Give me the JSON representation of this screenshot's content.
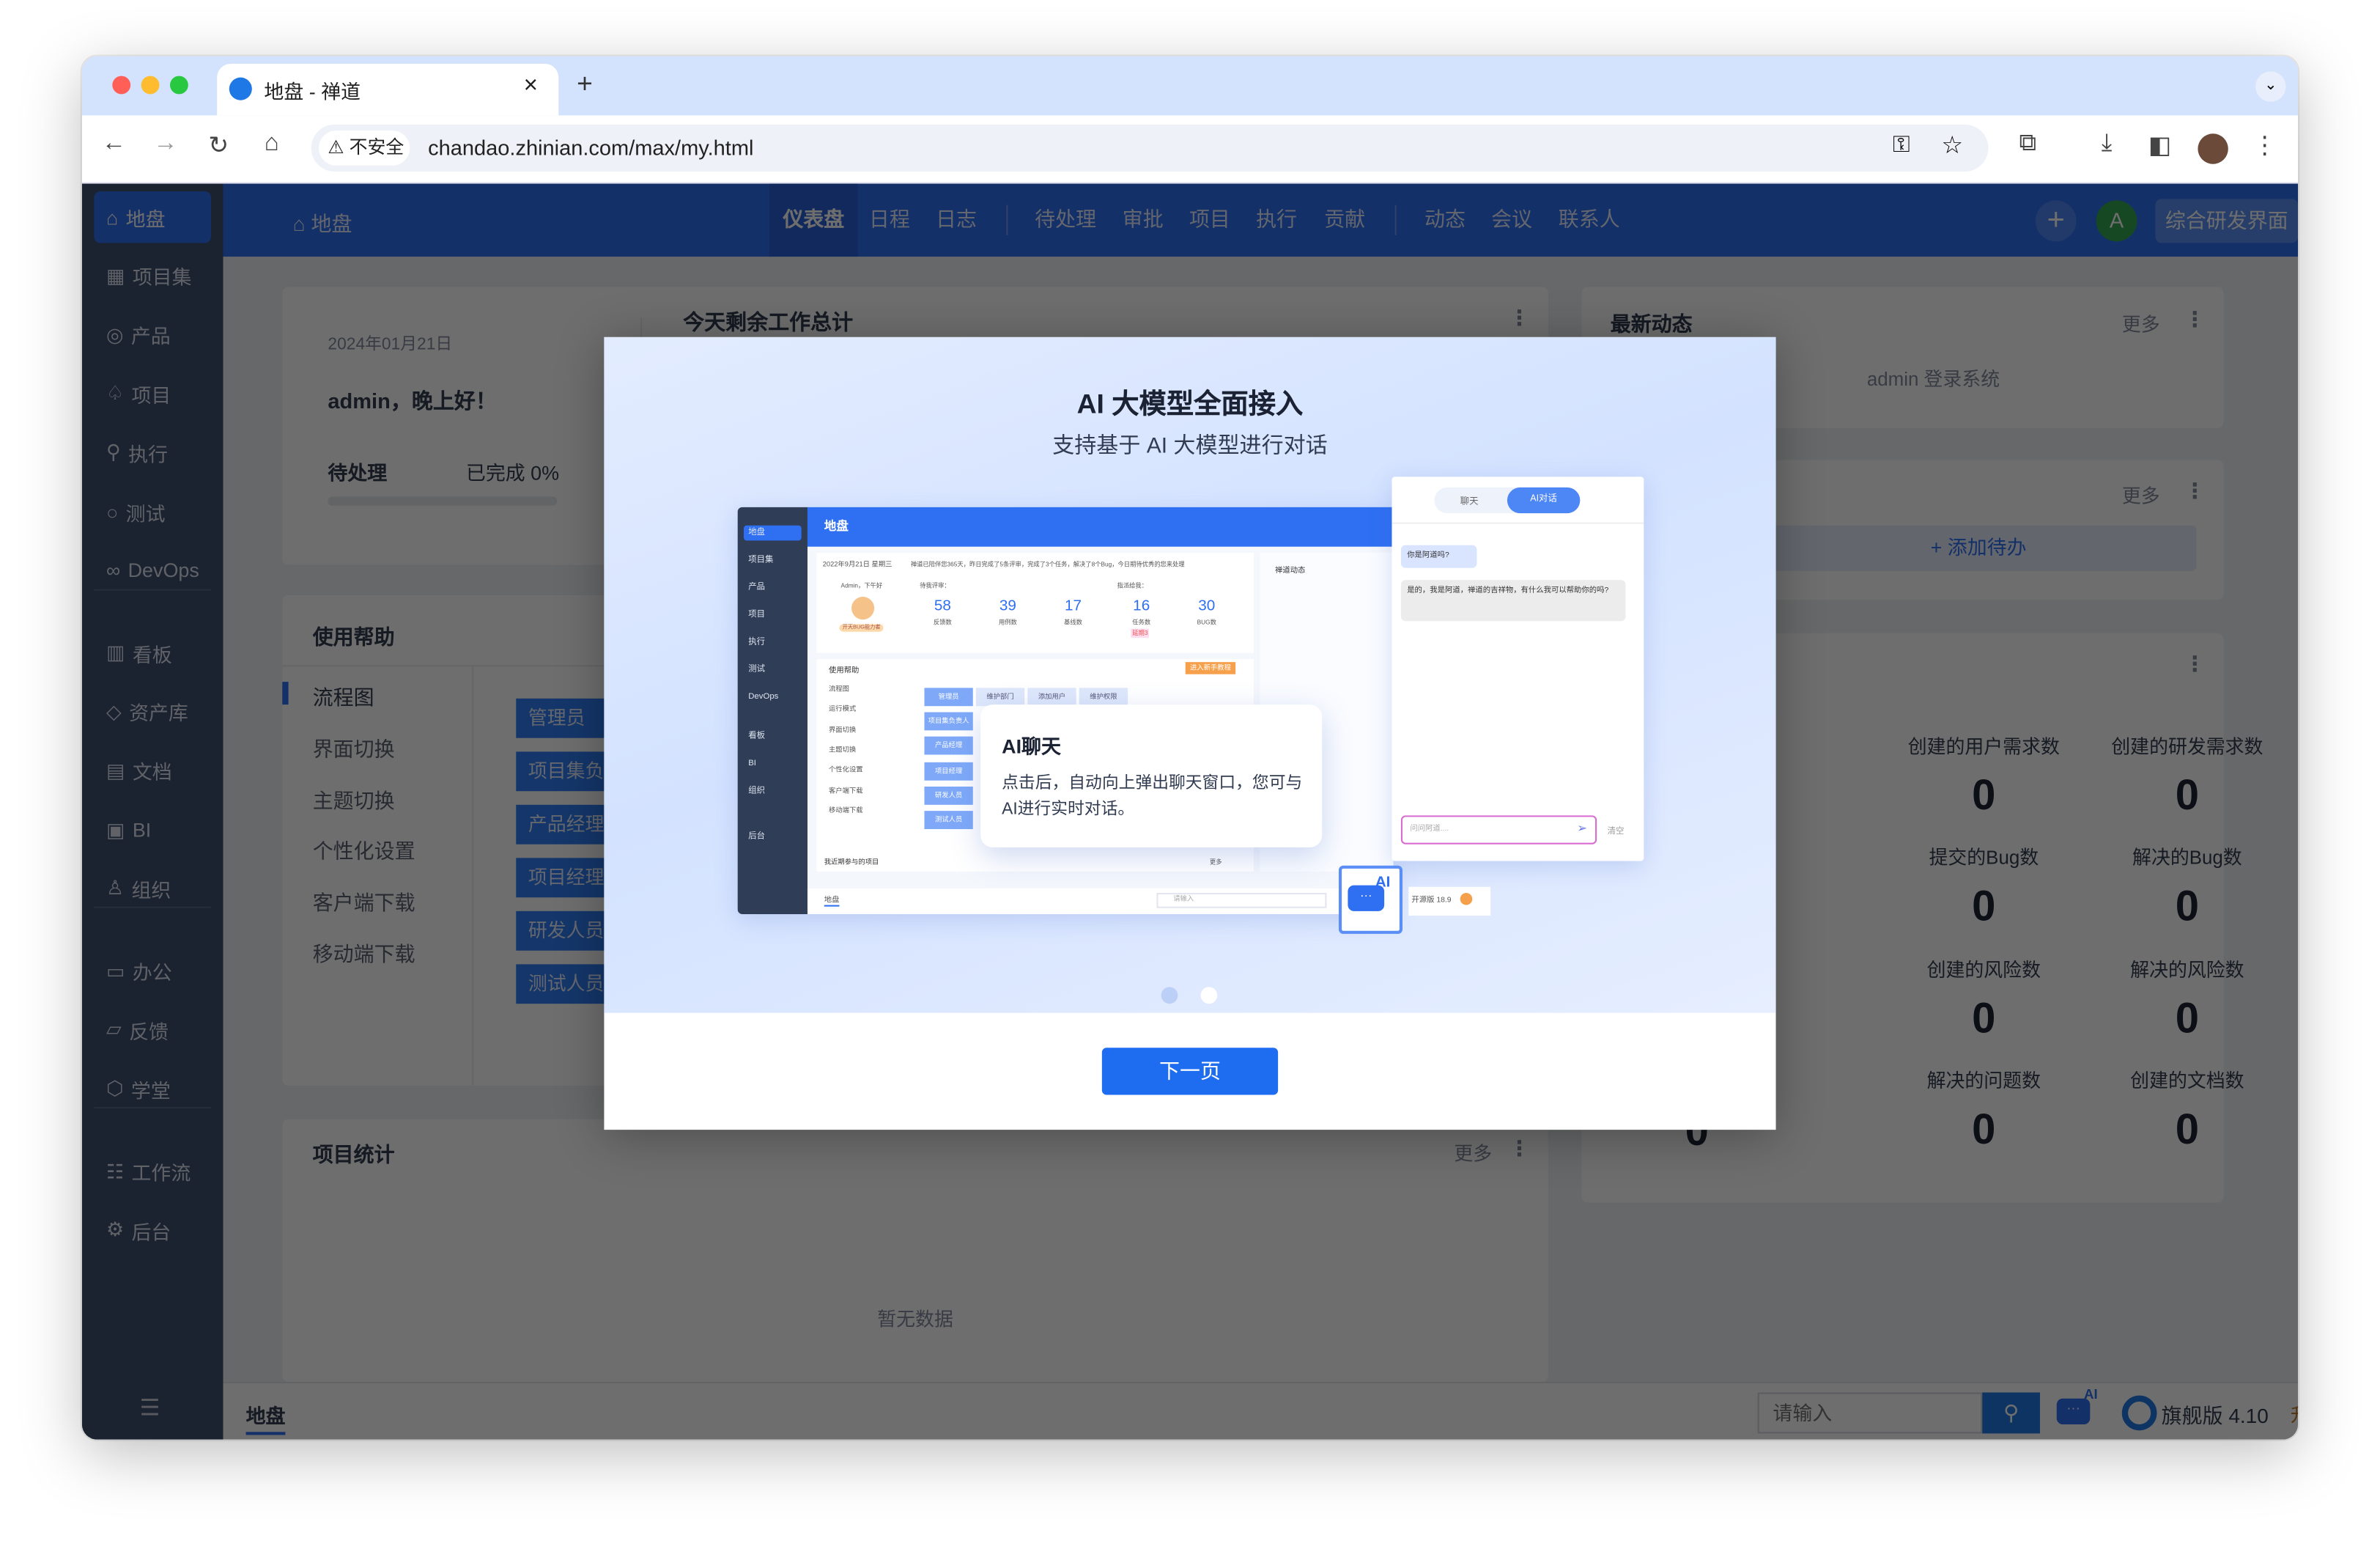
{
  "browser": {
    "tab_title": "地盘 - 禅道",
    "tab_close": "×",
    "new_tab": "+",
    "security_label": "不安全",
    "url": "chandao.zhinian.com/max/my.html"
  },
  "sidebar": {
    "groups": [
      [
        {
          "label": "地盘",
          "icon": "home-icon",
          "glyph": "⌂",
          "active": true
        },
        {
          "label": "项目集",
          "icon": "grid-icon",
          "glyph": "▦"
        },
        {
          "label": "产品",
          "icon": "lightbulb-icon",
          "glyph": "◎"
        },
        {
          "label": "项目",
          "icon": "bell-icon",
          "glyph": "♤"
        },
        {
          "label": "执行",
          "icon": "run-icon",
          "glyph": "⚲"
        },
        {
          "label": "测试",
          "icon": "search-icon",
          "glyph": "○"
        },
        {
          "label": "DevOps",
          "icon": "infinity-icon",
          "glyph": "∞"
        }
      ],
      [
        {
          "label": "看板",
          "icon": "board-icon",
          "glyph": "▥"
        },
        {
          "label": "资产库",
          "icon": "diamond-icon",
          "glyph": "◇"
        },
        {
          "label": "文档",
          "icon": "document-icon",
          "glyph": "▤"
        },
        {
          "label": "BI",
          "icon": "chart-icon",
          "glyph": "▣"
        },
        {
          "label": "组织",
          "icon": "people-icon",
          "glyph": "♙"
        }
      ],
      [
        {
          "label": "办公",
          "icon": "oa-icon",
          "glyph": "▭"
        },
        {
          "label": "反馈",
          "icon": "feedback-icon",
          "glyph": "▱"
        },
        {
          "label": "学堂",
          "icon": "cube-icon",
          "glyph": "⬡"
        }
      ],
      [
        {
          "label": "工作流",
          "icon": "workflow-icon",
          "glyph": "☷"
        },
        {
          "label": "后台",
          "icon": "gear-icon",
          "glyph": "⚙"
        }
      ]
    ]
  },
  "topnav": {
    "breadcrumb": "地盘",
    "items": [
      "仪表盘",
      "日程",
      "日志",
      "待处理",
      "审批",
      "项目",
      "执行",
      "贡献",
      "动态",
      "会议",
      "联系人"
    ],
    "active": "仪表盘",
    "add": "+",
    "avatar": "A",
    "switch_button": "综合研发界面"
  },
  "welcome": {
    "date": "2024年01月21日",
    "greeting": "admin，晚上好！",
    "pending": "待处理",
    "done": "已完成 0%",
    "progress": 0,
    "summary_title": "今天剩余工作总计"
  },
  "dynamics": {
    "title": "最新动态",
    "more": "更多",
    "entry": "admin  登录系统"
  },
  "todo": {
    "more": "更多",
    "add": "+ 添加待办"
  },
  "stats": {
    "left_value": "0",
    "items": [
      {
        "label": "创建的用户需求数",
        "value": "0"
      },
      {
        "label": "创建的研发需求数",
        "value": "0"
      },
      {
        "label": "提交的Bug数",
        "value": "0"
      },
      {
        "label": "解决的Bug数",
        "value": "0"
      },
      {
        "label": "创建的风险数",
        "value": "0"
      },
      {
        "label": "解决的风险数",
        "value": "0"
      },
      {
        "label": "解决的问题数",
        "value": "0"
      },
      {
        "label": "创建的文档数",
        "value": "0"
      }
    ]
  },
  "help": {
    "title": "使用帮助",
    "items": [
      "流程图",
      "界面切换",
      "主题切换",
      "个性化设置",
      "客户端下载",
      "移动端下载"
    ],
    "active": "流程图",
    "roles": [
      "管理员",
      "项目集负责人",
      "产品经理",
      "项目经理",
      "研发人员",
      "测试人员"
    ]
  },
  "project_stats": {
    "title": "项目统计",
    "more": "更多",
    "empty": "暂无数据"
  },
  "bottombar": {
    "tab": "地盘",
    "search_placeholder": "请输入",
    "ai_badge": "AI",
    "edition": "旗舰版 4.10",
    "upgrade": "升级"
  },
  "modal": {
    "title": "AI 大模型全面接入",
    "subtitle": "支持基于 AI 大模型进行对话",
    "next": "下一页",
    "page": 1,
    "pages": 2,
    "preview": {
      "sidebar": [
        "地盘",
        "项目集",
        "产品",
        "项目",
        "执行",
        "测试",
        "DevOps",
        "看板",
        "BI",
        "组织",
        "后台"
      ],
      "header": "地盘",
      "date_line": "2022年9月21日 星期三",
      "notice": "禅道已陪伴您365天，昨日完成了5条评审，完成了3个任务，解决了8个Bug，今日期待优秀的您来处理",
      "greet": "Admin，下午好",
      "badge": "开天BUG能力者",
      "review_label": "待我评审：",
      "assigned_label": "指派给我：",
      "numbers": [
        {
          "v": "58",
          "l": "反馈数"
        },
        {
          "v": "39",
          "l": "用例数"
        },
        {
          "v": "17",
          "l": "基线数"
        },
        {
          "v": "16",
          "l": "任务数"
        },
        {
          "v": "30",
          "l": "BUG数"
        }
      ],
      "delayed": "延期3",
      "help": "使用帮助",
      "tutorial": "进入新手教程",
      "help_items": [
        "流程图",
        "运行模式",
        "界面切换",
        "主题切换",
        "个性化设置",
        "客户端下载",
        "移动端下载"
      ],
      "flow_top": [
        "管理员",
        "维护部门",
        "添加用户",
        "维护权限"
      ],
      "flow_roles": [
        "项目集负责人",
        "产品经理",
        "项目经理",
        "研发人员",
        "测试人员"
      ],
      "news": "禅道动态",
      "recent": "我近期参与的项目",
      "more": "更多",
      "bottom_tab": "地盘",
      "search": "请输入",
      "edition": "开源版 18.9",
      "chat_tabs": [
        "聊天",
        "AI对话"
      ],
      "q": "你是阿道吗?",
      "a": "是的，我是阿道，禅道的吉祥物，有什么我可以帮助你的吗?",
      "input": "问问阿道....",
      "clear": "清空",
      "callout_title": "AI聊天",
      "callout_text": "点击后，自动向上弹出聊天窗口，您可与AI进行实时对话。",
      "ai_icon": "AI"
    }
  },
  "colors": {
    "brand": "#2f6ff2",
    "sidebar": "#3f4f70",
    "upgrade": "#e5484d",
    "avatar": "#34a853"
  }
}
